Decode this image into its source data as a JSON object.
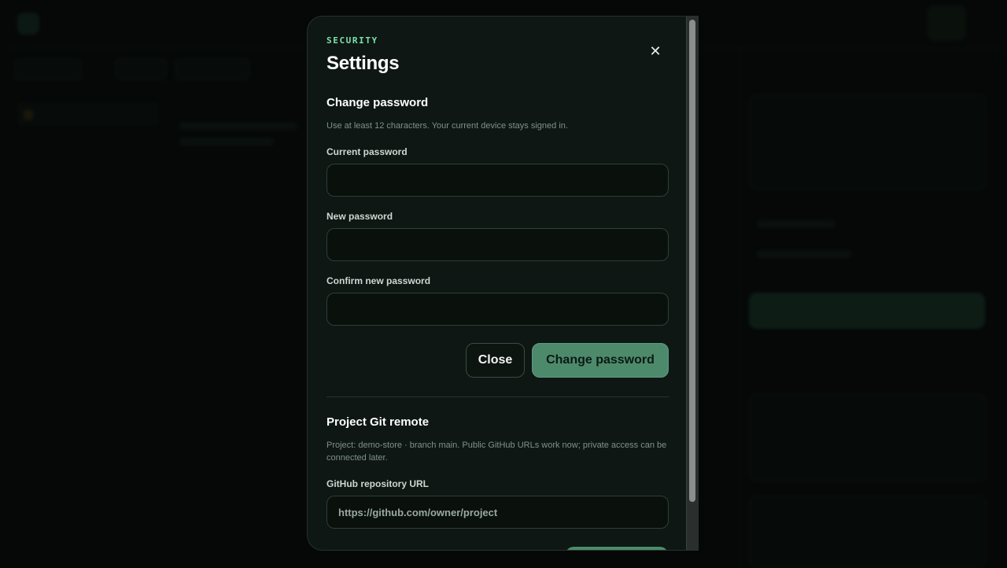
{
  "modal": {
    "eyebrow": "SECURITY",
    "title": "Settings",
    "close_icon": "close-icon"
  },
  "change_password": {
    "heading": "Change password",
    "help": "Use at least 12 characters. Your current device stays signed in.",
    "current_label": "Current password",
    "current_value": "",
    "new_label": "New password",
    "new_value": "",
    "confirm_label": "Confirm new password",
    "confirm_value": "",
    "close_button": "Close",
    "submit_button": "Change password"
  },
  "git_remote": {
    "heading": "Project Git remote",
    "help": "Project: demo-store · branch main. Public GitHub URLs work now; private access can be connected later.",
    "url_label": "GitHub repository URL",
    "url_placeholder": "https://github.com/owner/project",
    "url_value": ""
  },
  "colors": {
    "accent": "#7ee2b0",
    "primary_button": "#4d8a6c",
    "modal_bg": "#0e1713",
    "page_bg": "#050807"
  }
}
